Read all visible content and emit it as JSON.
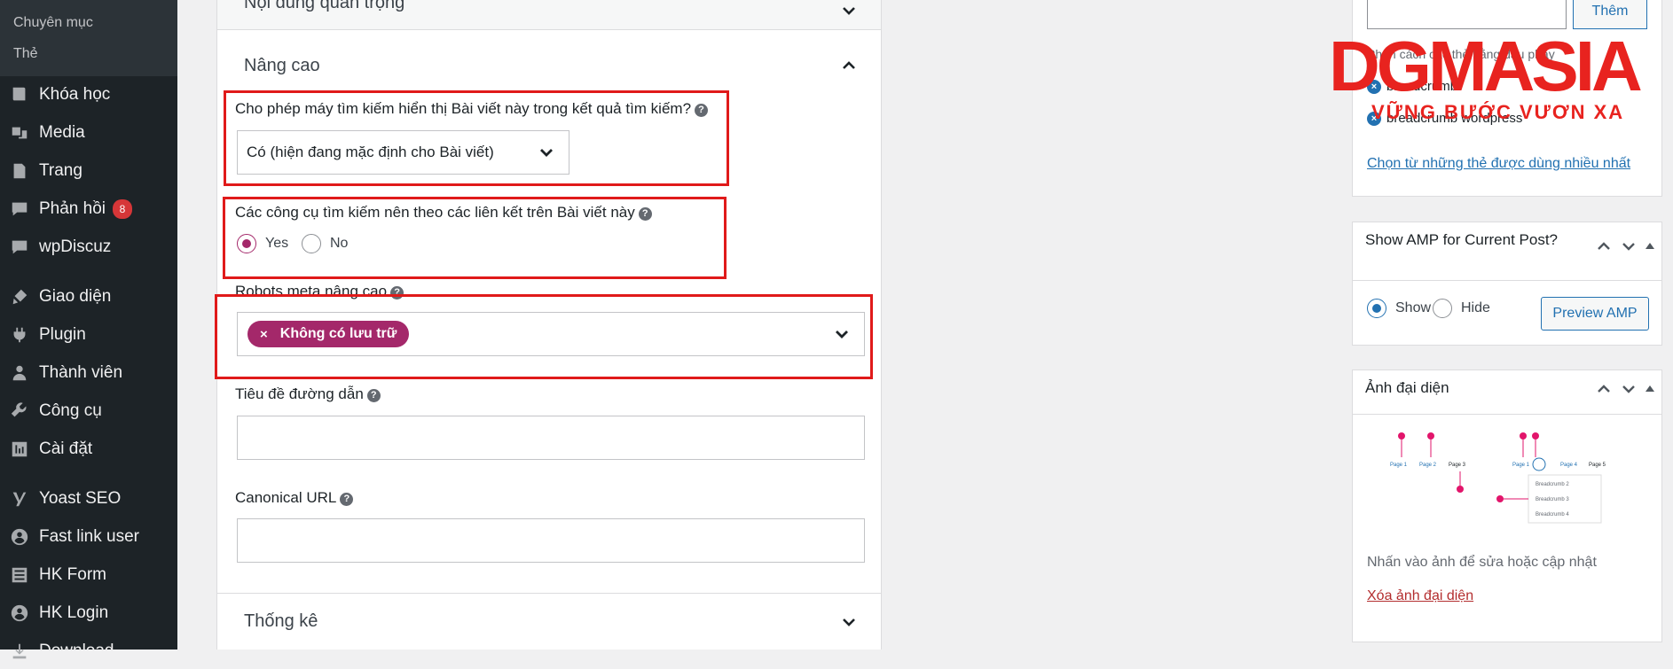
{
  "sidebar": {
    "sub_items": [
      "Chuyên mục",
      "Thẻ"
    ],
    "items": [
      {
        "label": "Khóa học",
        "icon": "book-icon"
      },
      {
        "label": "Media",
        "icon": "media-icon"
      },
      {
        "label": "Trang",
        "icon": "page-icon"
      },
      {
        "label": "Phản hồi",
        "icon": "comment-icon",
        "badge": "8"
      },
      {
        "label": "wpDiscuz",
        "icon": "discuss-icon"
      },
      {
        "label": "Giao diện",
        "icon": "brush-icon"
      },
      {
        "label": "Plugin",
        "icon": "plugin-icon"
      },
      {
        "label": "Thành viên",
        "icon": "user-icon"
      },
      {
        "label": "Công cụ",
        "icon": "wrench-icon"
      },
      {
        "label": "Cài đặt",
        "icon": "settings-icon"
      },
      {
        "label": "Yoast SEO",
        "icon": "yoast-icon"
      },
      {
        "label": "Fast link user",
        "icon": "user-circle-icon"
      },
      {
        "label": "HK Form",
        "icon": "form-icon"
      },
      {
        "label": "HK Login",
        "icon": "user-circle-icon"
      },
      {
        "label": "Download",
        "icon": "download-icon"
      }
    ]
  },
  "panel": {
    "section_top": "Nội dung quan trọng",
    "section_advanced": "Nâng cao",
    "search_visibility_label": "Cho phép máy tìm kiếm hiển thị Bài viết này trong kết quả tìm kiếm?",
    "search_visibility_value": "Có (hiện đang mặc định cho Bài viết)",
    "follow_links_label": "Các công cụ tìm kiếm nên theo các liên kết trên Bài viết này",
    "follow_yes": "Yes",
    "follow_no": "No",
    "robots_label": "Robots meta nâng cao",
    "robots_chip": "Không có lưu trữ",
    "breadcrumb_title_label": "Tiêu đề đường dẫn",
    "breadcrumb_title_value": "",
    "canonical_label": "Canonical URL",
    "canonical_value": "",
    "section_stats": "Thống kê"
  },
  "right": {
    "tags_add_button": "Thêm",
    "tags_hint": "Phân cách các thẻ bằng dấu phẩy",
    "tags": [
      "breadcrumb",
      "breadcrumb wordpress"
    ],
    "tags_most_used_link": "Chọn từ những thẻ được dùng nhiều nhất",
    "amp_title": "Show AMP for Current Post?",
    "amp_show": "Show",
    "amp_hide": "Hide",
    "amp_preview_button": "Preview AMP",
    "featured_title": "Ảnh đại diện",
    "featured_hint": "Nhấn vào ảnh để sửa hoặc cập nhật",
    "featured_remove_link": "Xóa ảnh đại diện",
    "featured_image_labels": {
      "page1": "Page 1",
      "page2": "Page 2",
      "page3": "Page 3",
      "page4": "Page 4",
      "page5": "Page 5",
      "bc2": "Breadcrumb 2",
      "bc3": "Breadcrumb 3",
      "bc4": "Breadcrumb 4"
    }
  },
  "watermark": {
    "brand": "DGMASIA",
    "slogan": "VỮNG BƯỚC VƯƠN XA",
    "color": "#e8231f"
  },
  "colors": {
    "accent": "#a4286a",
    "highlight_box": "#e01a1a",
    "link": "#2271b1"
  }
}
